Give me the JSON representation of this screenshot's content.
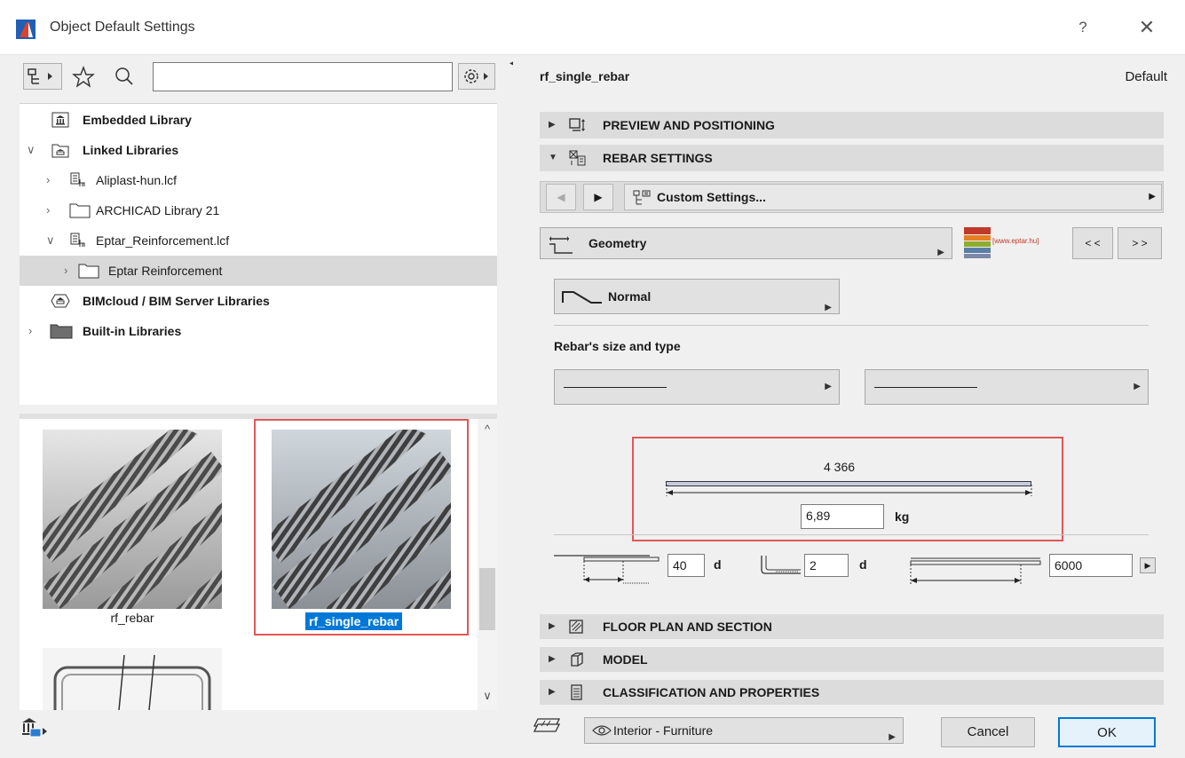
{
  "window": {
    "title": "Object Default Settings",
    "help": "?",
    "close": "✕"
  },
  "library_tree": [
    {
      "label": "Embedded Library",
      "bold": true
    },
    {
      "label": "Linked Libraries",
      "bold": true
    },
    {
      "label": "Aliplast-hun.lcf",
      "bold": false
    },
    {
      "label": "ARCHICAD Library 21",
      "bold": false
    },
    {
      "label": "Eptar_Reinforcement.lcf",
      "bold": false
    },
    {
      "label": "Eptar Reinforcement",
      "bold": false,
      "selected": true
    },
    {
      "label": "BIMcloud / BIM Server Libraries",
      "bold": true
    },
    {
      "label": "Built-in Libraries",
      "bold": true
    }
  ],
  "thumbnails": [
    {
      "caption": "rf_rebar"
    },
    {
      "caption": "rf_single_rebar",
      "selected": true
    }
  ],
  "settings": {
    "object_name": "rf_single_rebar",
    "default_label": "Default",
    "sections": {
      "preview": "PREVIEW AND POSITIONING",
      "rebar": "REBAR SETTINGS",
      "floor_plan": "FLOOR PLAN AND SECTION",
      "model": "MODEL",
      "classification": "CLASSIFICATION AND PROPERTIES"
    },
    "custom_settings": "Custom Settings...",
    "geometry": "Geometry",
    "brand_text": "[www.eptar.hu]",
    "prev_page": "< <",
    "next_page": "> >",
    "shape": "Normal",
    "size_type_label": "Rebar's size and type",
    "length_value": "4 366",
    "weight_value": "6,89",
    "weight_unit": "kg",
    "anchor_value": "40",
    "anchor_unit": "d",
    "hook_value": "2",
    "hook_unit": "d",
    "total_length": "6000"
  },
  "bottom": {
    "layer": "Interior - Furniture",
    "cancel": "Cancel",
    "ok": "OK"
  }
}
